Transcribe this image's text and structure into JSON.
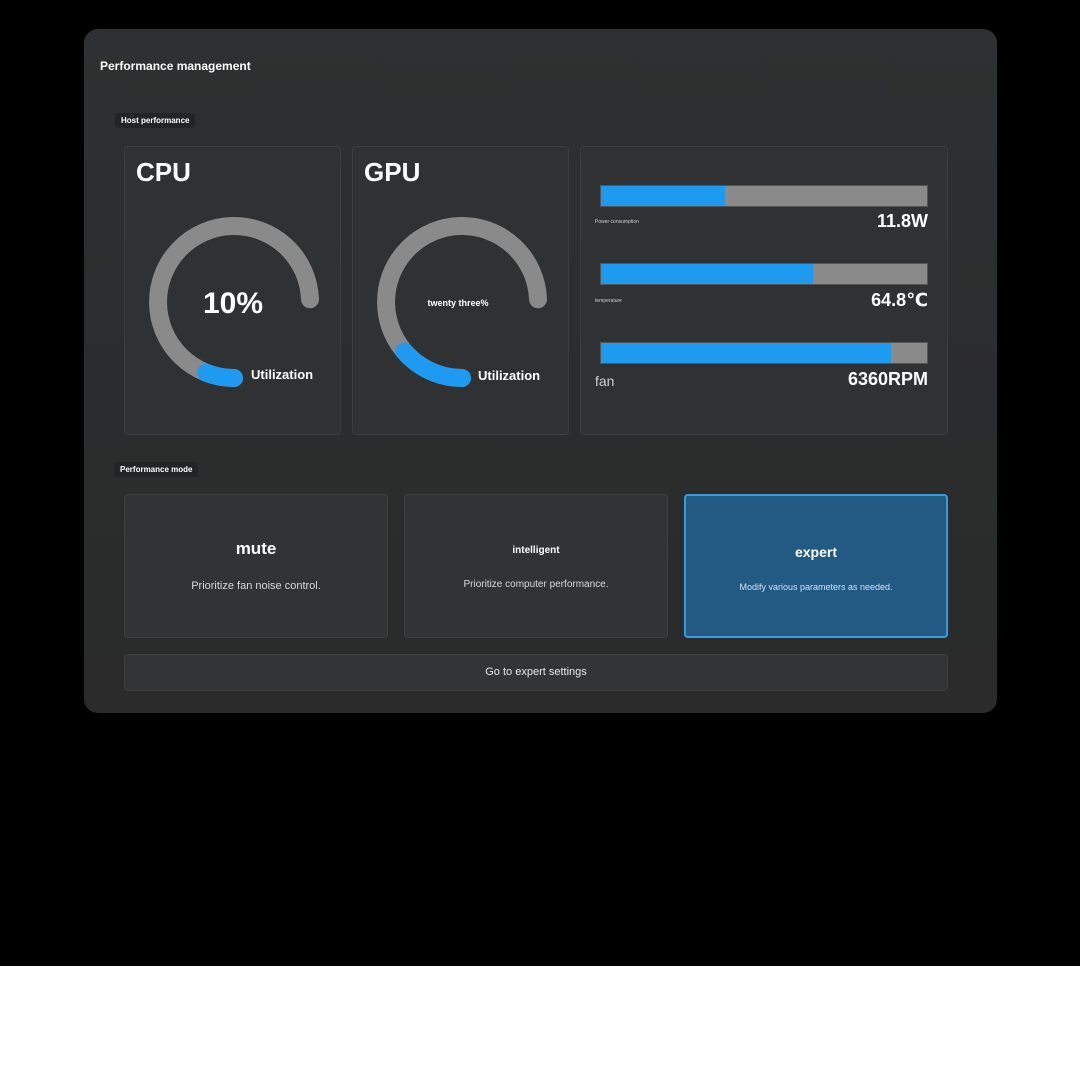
{
  "panel": {
    "title": "Performance management"
  },
  "host": {
    "label": "Host performance",
    "cpu": {
      "title": "CPU",
      "value": "10%",
      "unit": "Utilization",
      "fraction": 0.1
    },
    "gpu": {
      "title": "GPU",
      "value": "twenty three%",
      "unit": "Utilization",
      "fraction": 0.23
    },
    "metrics": [
      {
        "label": "Power consumption",
        "value": "11.8W",
        "fraction": 0.38
      },
      {
        "label": "temperature",
        "value": "64.8℃",
        "fraction": 0.65
      },
      {
        "label": "fan",
        "value": "6360RPM",
        "fraction": 0.89
      }
    ]
  },
  "mode": {
    "label": "Performance mode",
    "options": [
      {
        "name": "mute",
        "desc": "Prioritize fan noise control."
      },
      {
        "name": "intelligent",
        "desc": "Prioritize computer performance."
      },
      {
        "name": "expert",
        "desc": "Modify various parameters as needed."
      }
    ],
    "selected": "expert"
  },
  "expert_button": {
    "label": "Go to expert settings"
  },
  "colors": {
    "accent": "#1e9bf0",
    "track": "#8a8a8a",
    "selected_card": "#235a84"
  }
}
